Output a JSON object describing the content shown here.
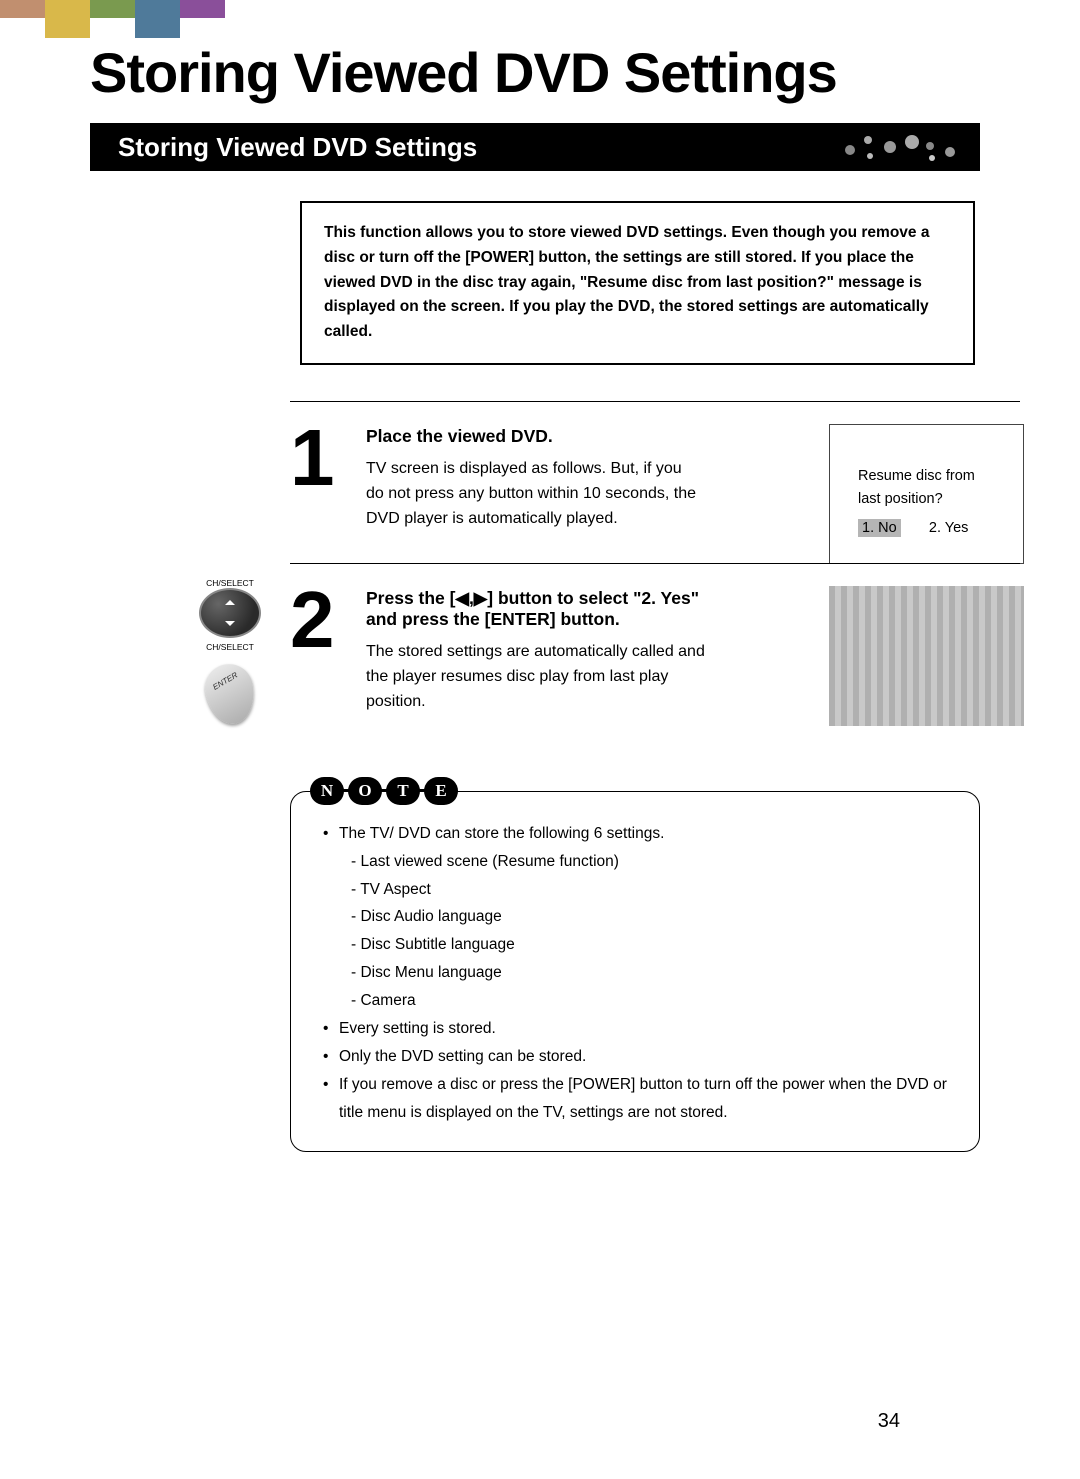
{
  "page": {
    "main_title": "Storing Viewed DVD Settings",
    "section_title": "Storing Viewed DVD Settings",
    "page_number": "34"
  },
  "intro": "This function allows you to store viewed DVD settings. Even though you remove  a disc or turn off the [POWER] button, the settings are still stored. If you place the viewed DVD in the disc tray again, \"Resume disc from last position?\"  message is displayed on the screen. If you play the DVD, the stored settings are automatically called.",
  "steps": [
    {
      "num": "1",
      "title": "Place the viewed DVD.",
      "body": "TV screen is displayed as follows. But, if you do not press any button within 10 seconds, the DVD player is automatically played."
    },
    {
      "num": "2",
      "title": "Press the [◀,▶] button to select \"2. Yes\" and press the [ENTER] button.",
      "body": "The stored settings are automatically called and the player resumes disc play from last play position."
    }
  ],
  "dialog": {
    "line1": "Resume disc from",
    "line2": "last position?",
    "opt1": "1. No",
    "opt2": "2. Yes"
  },
  "remote": {
    "ch_label": "CH/SELECT",
    "enter_label": "ENTER"
  },
  "note": {
    "letters": [
      "N",
      "O",
      "T",
      "E"
    ],
    "items": [
      "The TV/ DVD can store the following 6 settings.",
      "Every setting is stored.",
      "Only the DVD setting can be stored.",
      "If you remove a disc or press the [POWER] button to turn off the power when the DVD or title menu is displayed on the TV, settings are not stored."
    ],
    "subitems": [
      "- Last viewed scene (Resume function)",
      "- TV Aspect",
      "- Disc Audio language",
      "- Disc Subtitle language",
      "- Disc Menu language",
      "- Camera"
    ]
  }
}
